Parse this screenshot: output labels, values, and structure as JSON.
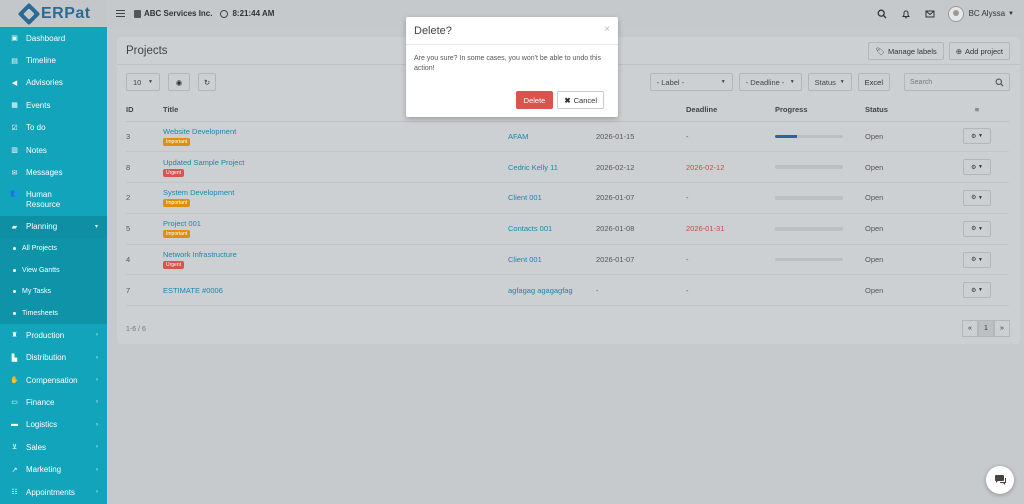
{
  "brand": {
    "name": "ERPat"
  },
  "topbar": {
    "company": "ABC Services Inc.",
    "time": "8:21:44 AM",
    "user": "BC Alyssa"
  },
  "sidebar": {
    "items": [
      {
        "label": "Dashboard",
        "icon": "dashboard-icon"
      },
      {
        "label": "Timeline",
        "icon": "timeline-icon"
      },
      {
        "label": "Advisories",
        "icon": "bullhorn-icon"
      },
      {
        "label": "Events",
        "icon": "calendar-icon"
      },
      {
        "label": "To do",
        "icon": "checkbox-icon"
      },
      {
        "label": "Notes",
        "icon": "notes-icon"
      },
      {
        "label": "Messages",
        "icon": "envelope-icon"
      },
      {
        "label": "Human Resource",
        "label1": "Human",
        "label2": "Resource",
        "icon": "users-icon"
      },
      {
        "label": "Planning",
        "icon": "briefcase-icon"
      }
    ],
    "planning_sub": [
      "All Projects",
      "View Gantts",
      "My Tasks",
      "Timesheets"
    ],
    "items_after": [
      {
        "label": "Production",
        "icon": "production-icon"
      },
      {
        "label": "Distribution",
        "icon": "building-icon"
      },
      {
        "label": "Compensation",
        "icon": "handshake-icon"
      },
      {
        "label": "Finance",
        "icon": "money-icon"
      },
      {
        "label": "Logistics",
        "icon": "truck-icon"
      },
      {
        "label": "Sales",
        "icon": "cart-icon"
      },
      {
        "label": "Marketing",
        "icon": "chart-icon"
      },
      {
        "label": "Appointments",
        "icon": "appointment-icon"
      }
    ]
  },
  "projects": {
    "title": "Projects",
    "manage_labels": "Manage labels",
    "add_project": "Add project",
    "page_size": "10",
    "label_filter": "- Label -",
    "deadline_filter": "- Deadline -",
    "status_filter": "Status",
    "excel": "Excel",
    "search_placeholder": "Search",
    "columns": {
      "id": "ID",
      "title": "Title",
      "start_date": "ate",
      "deadline": "Deadline",
      "progress": "Progress",
      "status": "Status"
    },
    "rows": [
      {
        "id": "3",
        "title": "Website Development",
        "tag": "Important",
        "tag_color": "#e08e0b",
        "client": "AFAM",
        "start": "2026-01-15",
        "deadline": "-",
        "deadline_red": false,
        "progress": 0.32,
        "status": "Open"
      },
      {
        "id": "8",
        "title": "Updated Sample Project",
        "tag": "Urgent",
        "tag_color": "#d9534f",
        "client": "Cedric Kelly 11",
        "start": "2026-02-12",
        "deadline": "2026-02-12",
        "deadline_red": true,
        "progress": 0,
        "status": "Open"
      },
      {
        "id": "2",
        "title": "System Development",
        "tag": "Important",
        "tag_color": "#e08e0b",
        "client": "Client 001",
        "start": "2026-01-07",
        "deadline": "-",
        "deadline_red": false,
        "progress": 0,
        "status": "Open"
      },
      {
        "id": "5",
        "title": "Project 001",
        "tag": "Important",
        "tag_color": "#e08e0b",
        "client": "Contacts 001",
        "start": "2026-01-08",
        "deadline": "2026-01-31",
        "deadline_red": true,
        "progress": 0,
        "status": "Open"
      },
      {
        "id": "4",
        "title": "Network Infrastructure",
        "tag": "Urgent",
        "tag_color": "#d9534f",
        "client": "Client 001",
        "start": "2026-01-07",
        "deadline": "-",
        "deadline_red": false,
        "progress": 0,
        "status": "Open"
      },
      {
        "id": "7",
        "title": "ESTIMATE #0006",
        "tag": "",
        "tag_color": "",
        "client": "agfagag agagagfag",
        "start": "-",
        "deadline": "-",
        "deadline_red": false,
        "progress": 0,
        "status": "Open"
      }
    ],
    "footer_count": "1-6 / 6",
    "current_page": "1"
  },
  "modal": {
    "title": "Delete?",
    "body": "Are you sure? In some cases, you won't be able to undo this action!",
    "delete": "Delete",
    "cancel": "Cancel"
  }
}
